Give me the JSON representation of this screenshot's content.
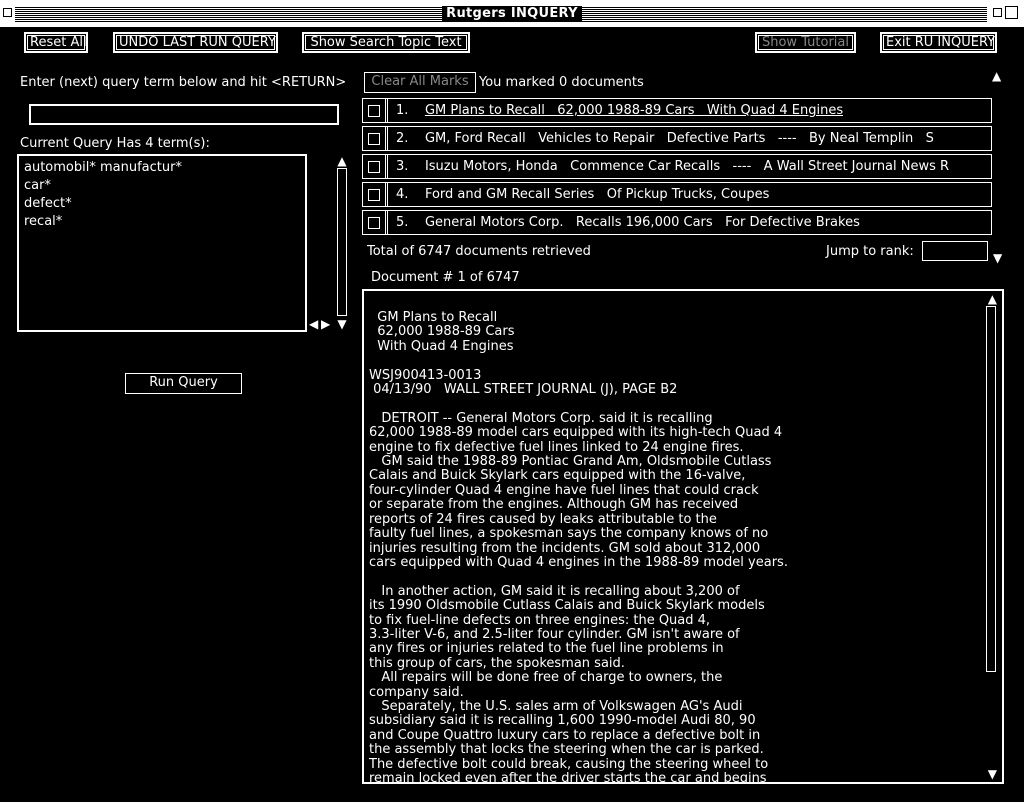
{
  "window": {
    "title": "Rutgers INQUERY"
  },
  "toolbar": {
    "reset_all": "Reset All",
    "undo": "UNDO LAST RUN QUERY",
    "show_topic": "Show Search Topic Text",
    "show_tutorial": "Show Tutorial",
    "exit": "Exit RU INQUERY"
  },
  "query": {
    "prompt": "Enter (next) query term below and hit <RETURN>",
    "input_value": "",
    "count_label": "Current Query Has  4  term(s):",
    "terms": [
      "automobil* manufactur*",
      "car*",
      "defect*",
      "recal*"
    ],
    "run_button": "Run Query"
  },
  "marks": {
    "clear_button": "Clear All Marks",
    "status": "You marked  0  documents"
  },
  "results": [
    {
      "rank": "1.",
      "text": "GM Plans to Recall   62,000 1988-89 Cars   With Quad 4 Engines"
    },
    {
      "rank": "2.",
      "text": "GM, Ford Recall   Vehicles to Repair   Defective Parts   ----   By Neal Templin   S"
    },
    {
      "rank": "3.",
      "text": "Isuzu Motors, Honda   Commence Car Recalls   ----   A Wall Street Journal News R"
    },
    {
      "rank": "4.",
      "text": "Ford and GM Recall Series   Of Pickup Trucks, Coupes"
    },
    {
      "rank": "5.",
      "text": "General Motors Corp.   Recalls 196,000 Cars   For Defective Brakes"
    }
  ],
  "summary": {
    "total": "Total of  6747  documents retrieved",
    "jump_label": "Jump to rank:",
    "doc_position": "Document # 1 of 6747"
  },
  "document": {
    "text": "  GM Plans to Recall\n  62,000 1988-89 Cars\n  With Quad 4 Engines\n\nWSJ900413-0013\n 04/13/90   WALL STREET JOURNAL (J), PAGE B2\n\n   DETROIT -- General Motors Corp. said it is recalling\n62,000 1988-89 model cars equipped with its high-tech Quad 4\nengine to fix defective fuel lines linked to 24 engine fires.\n   GM said the 1988-89 Pontiac Grand Am, Oldsmobile Cutlass\nCalais and Buick Skylark cars equipped with the 16-valve,\nfour-cylinder Quad 4 engine have fuel lines that could crack\nor separate from the engines. Although GM has received\nreports of 24 fires caused by leaks attributable to the\nfaulty fuel lines, a spokesman says the company knows of no\ninjuries resulting from the incidents. GM sold about 312,000\ncars equipped with Quad 4 engines in the 1988-89 model years.\n\n   In another action, GM said it is recalling about 3,200 of\nits 1990 Oldsmobile Cutlass Calais and Buick Skylark models\nto fix fuel-line defects on three engines: the Quad 4,\n3.3-liter V-6, and 2.5-liter four cylinder. GM isn't aware of\nany fires or injuries related to the fuel line problems in\nthis group of cars, the spokesman said.\n   All repairs will be done free of charge to owners, the\ncompany said.\n   Separately, the U.S. sales arm of Volkswagen AG's Audi\nsubsidiary said it is recalling 1,600 1990-model Audi 80, 90\nand Coupe Quattro luxury cars to replace a defective bolt in\nthe assembly that locks the steering when the car is parked.\nThe defective bolt could break, causing the steering wheel to\nremain locked even after the driver starts the car and begins"
  },
  "icons": {
    "up": "▲",
    "down": "▼",
    "left": "◀",
    "right": "▶"
  },
  "colors": {
    "background": "#000000",
    "foreground": "#ffffff",
    "disabled": "#888888"
  }
}
